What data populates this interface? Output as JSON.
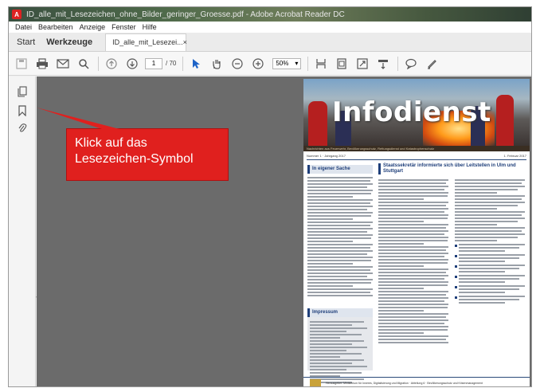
{
  "window": {
    "title": "ID_alle_mit_Lesezeichen_ohne_Bilder_geringer_Groesse.pdf - Adobe Acrobat Reader DC"
  },
  "menu": [
    "Datei",
    "Bearbeiten",
    "Anzeige",
    "Fenster",
    "Hilfe"
  ],
  "tabs": {
    "start": "Start",
    "tools": "Werkzeuge",
    "document": "ID_alle_mit_Lesezei...",
    "close": "×"
  },
  "toolbar": {
    "current_page": "1",
    "total_pages": "/ 70",
    "zoom": "50%"
  },
  "callout": {
    "line1": "Klick auf das",
    "line2": "Lesezeichen-Symbol"
  },
  "page": {
    "banner_title": "Infodienst",
    "banner_strip": "Nachrichten aus Feuerwehr, Bevölkerungsschutz, Rettungsdienst und Katastrophenschutz",
    "issue": "Nummer 1 · Jahrgang 2017",
    "date": "1. Februar 2017",
    "sidebar_heading": "In eigener Sache",
    "article_heading": "Staatssekretär informierte sich über Leitstellen in Ulm und Stuttgart",
    "impressum_heading": "Impressum",
    "footer": "Herausgeber: Ministerium für Inneres, Digitalisierung und Migration · Abteilung 6 · Bevölkerungsschutz und Krisenmanagement"
  },
  "colors": {
    "callout": "#e0201e",
    "accent": "#1f3f7a",
    "docarea": "#6b6b6b"
  }
}
